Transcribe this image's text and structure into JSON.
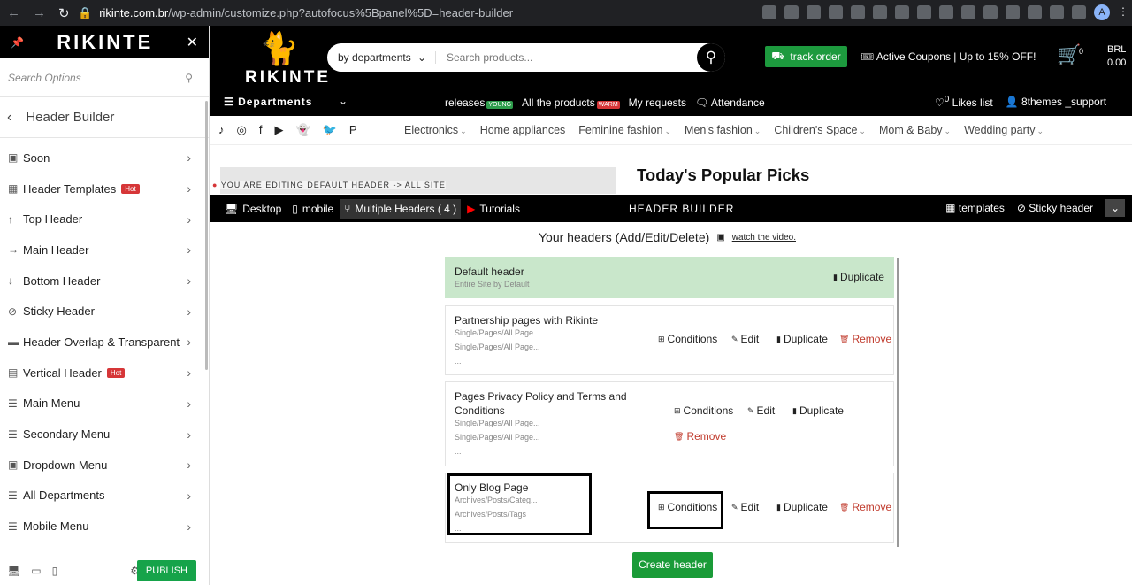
{
  "browser": {
    "url_host": "rikinte.com.br",
    "url_path": "/wp-admin/customize.php?autofocus%5Bpanel%5D=header-builder",
    "profile_initial": "A"
  },
  "sidebar": {
    "brand": "RIKINTE",
    "search_placeholder": "Search Options",
    "section_title": "Header Builder",
    "items": [
      {
        "label": "Soon",
        "icon": "image-icon",
        "badge": ""
      },
      {
        "label": "Header Templates",
        "icon": "grid-icon",
        "badge": "Hot"
      },
      {
        "label": "Top Header",
        "icon": "arrow-up-icon",
        "badge": ""
      },
      {
        "label": "Main Header",
        "icon": "arrow-right-icon",
        "badge": ""
      },
      {
        "label": "Bottom Header",
        "icon": "arrow-down-icon",
        "badge": ""
      },
      {
        "label": "Sticky Header",
        "icon": "paperclip-icon",
        "badge": ""
      },
      {
        "label": "Header Overlap & Transparent",
        "icon": "overlap-icon",
        "badge": ""
      },
      {
        "label": "Vertical Header",
        "icon": "document-icon",
        "badge": "Hot"
      },
      {
        "label": "Main Menu",
        "icon": "menu-icon",
        "badge": ""
      },
      {
        "label": "Secondary Menu",
        "icon": "menu-icon",
        "badge": ""
      },
      {
        "label": "Dropdown Menu",
        "icon": "dropdown-icon",
        "badge": ""
      },
      {
        "label": "All Departments",
        "icon": "menu-icon",
        "badge": ""
      },
      {
        "label": "Mobile Menu",
        "icon": "menu-icon",
        "badge": ""
      }
    ],
    "publish_label": "PUBLISH"
  },
  "site_header": {
    "logo": "RIKINTE",
    "search_dept": "by departments",
    "search_placeholder": "Search products...",
    "track_order": "track order",
    "coupon": "Active Coupons | Up to 15% OFF!",
    "cart_count": "0",
    "currency": "BRL",
    "amount": "0.00",
    "departments": "Departments",
    "links": [
      {
        "label": "releases",
        "tag": "YOUNG",
        "tag_color": "#2e9d4c"
      },
      {
        "label": "All the products",
        "tag": "WARM",
        "tag_color": "#d63638"
      },
      {
        "label": "My requests",
        "tag": "",
        "tag_color": ""
      },
      {
        "label": "Attendance",
        "tag": "",
        "tag_color": ""
      }
    ],
    "likes_count": "0",
    "likes_label": "Likes list",
    "account": "8themes _support",
    "categories": [
      "Electronics",
      "Home appliances",
      "Feminine fashion",
      "Men's fashion",
      "Children's Space",
      "Mom & Baby",
      "Wedding party"
    ],
    "categories_with_dropdown": [
      true,
      false,
      true,
      true,
      true,
      true,
      true
    ],
    "editing_notice": "YOU ARE EDITING DEFAULT HEADER -> ALL SITE",
    "popular_title": "Today's Popular Picks"
  },
  "builder": {
    "modes": [
      "Desktop",
      "mobile",
      "Multiple Headers ( 4 )",
      "Tutorials"
    ],
    "title": "HEADER BUILDER",
    "templates": "templates",
    "sticky": "Sticky header",
    "heading": "Your headers (Add/Edit/Delete)",
    "video": "watch the video.",
    "headers": [
      {
        "name": "Default header",
        "conditions": [
          "Entire Site by Default"
        ]
      },
      {
        "name": "Partnership pages with Rikinte",
        "conditions": [
          "Single/Pages/All Page...",
          "Single/Pages/All Page...",
          "..."
        ]
      },
      {
        "name": "Pages Privacy Policy and Terms and Conditions",
        "conditions": [
          "Single/Pages/All Page...",
          "Single/Pages/All Page...",
          "..."
        ]
      },
      {
        "name": "Only Blog Page",
        "conditions": [
          "Archives/Posts/Categ...",
          "Archives/Posts/Tags",
          "..."
        ]
      }
    ],
    "actions": {
      "conditions": "Conditions",
      "edit": "Edit",
      "duplicate": "Duplicate",
      "remove": "Remove"
    },
    "create": "Create header"
  }
}
